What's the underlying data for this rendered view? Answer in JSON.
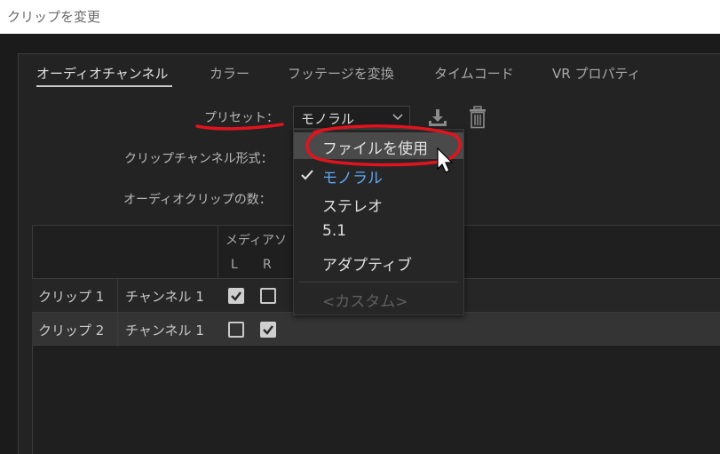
{
  "window": {
    "title": "クリップを変更"
  },
  "tabs": [
    {
      "label": "オーディオチャンネル",
      "active": true
    },
    {
      "label": "カラー"
    },
    {
      "label": "フッテージを変換"
    },
    {
      "label": "タイムコード"
    },
    {
      "label": "VR プロパティ"
    }
  ],
  "form": {
    "preset_label": "プリセット：",
    "preset_value": "モノラル",
    "clip_channel_format_label": "クリップチャンネル形式：",
    "audio_clip_count_label": "オーディオクリップの数："
  },
  "icons": {
    "save": "download-save-icon",
    "delete": "trash-icon",
    "chevron": "chevron-down-icon",
    "check": "checkmark-icon"
  },
  "grid": {
    "media_source_header": "メディアソ",
    "channel_headers": [
      "L",
      "R"
    ],
    "rows": [
      {
        "clip": "クリップ 1",
        "channel": "チャンネル 1",
        "L": true,
        "R": false
      },
      {
        "clip": "クリップ 2",
        "channel": "チャンネル 1",
        "L": false,
        "R": true
      }
    ]
  },
  "dropdown": {
    "items": [
      {
        "label": "ファイルを使用",
        "state": "hover"
      },
      {
        "label": "モノラル",
        "state": "selected"
      },
      {
        "label": "ステレオ"
      },
      {
        "label": "5.1"
      },
      {
        "label": "アダプティブ"
      },
      {
        "label": "<カスタム>",
        "state": "disabled"
      }
    ]
  },
  "colors": {
    "accent_selected": "#5fa8f5",
    "annotation_red": "#e0141e",
    "background": "#232323"
  }
}
